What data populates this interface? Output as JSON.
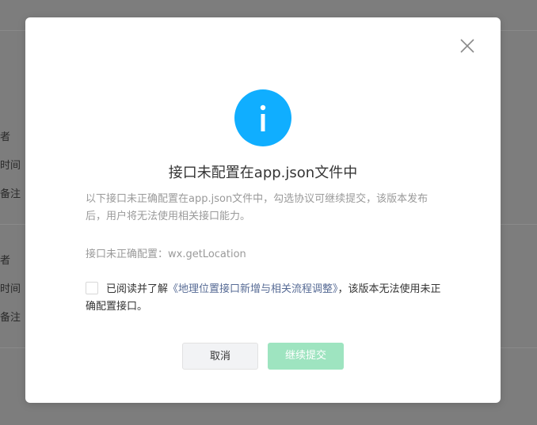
{
  "background": {
    "labels": [
      "者",
      "时间",
      "备注",
      "者",
      "时间",
      "备注"
    ]
  },
  "dialog": {
    "close_icon": "close-icon",
    "info_icon": "info-icon",
    "info_color": "#10aeff",
    "title": "接口未配置在app.json文件中",
    "description": "以下接口未正确配置在app.json文件中，勾选协议可继续提交，该版本发布后，用户将无法使用相关接口能力。",
    "misconfigured_label": "接口未正确配置：wx.getLocation",
    "agreement": {
      "prefix": "已阅读并了解",
      "link": "《地理位置接口新增与相关流程调整》",
      "suffix": "，该版本无法使用未正确配置接口。",
      "checked": false
    },
    "buttons": {
      "cancel": "取消",
      "continue": "继续提交",
      "continue_color": "#9ee4c0"
    }
  }
}
